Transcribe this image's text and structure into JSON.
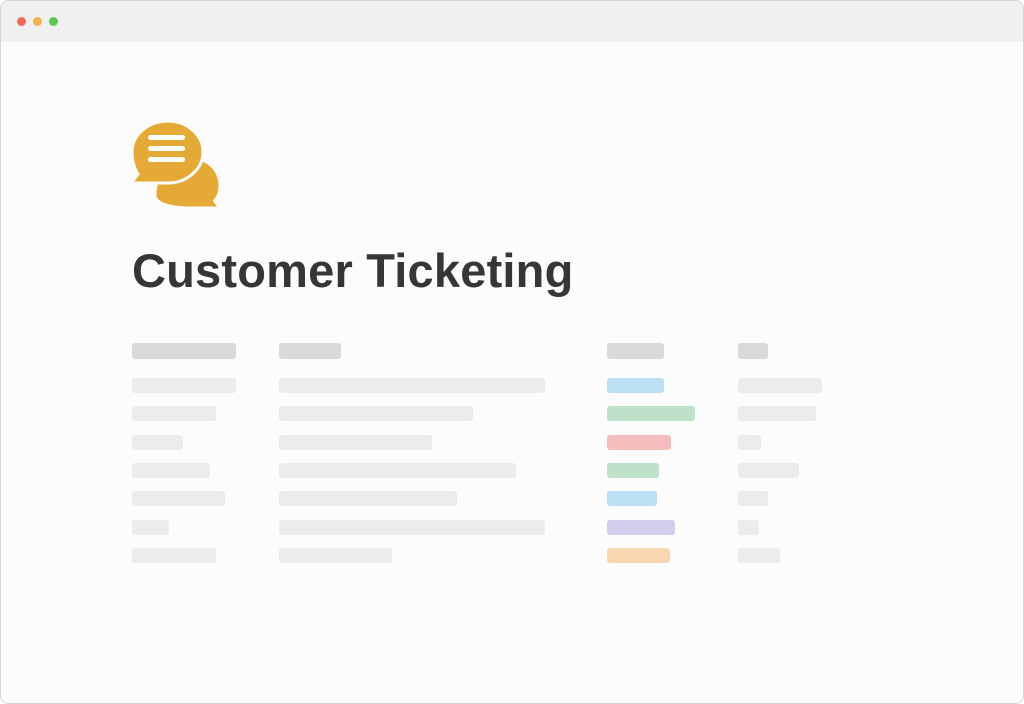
{
  "window": {
    "traffic_lights": [
      "close",
      "minimize",
      "zoom"
    ]
  },
  "page": {
    "icon": "chat-bubbles-icon",
    "icon_color": "#E5A935",
    "title": "Customer Ticketing"
  },
  "table": {
    "columns": 4,
    "rows": 7,
    "status_tag_colors": [
      "#BDDFF4",
      "#BFE0C9",
      "#F5BDBD",
      "#BFE0C9",
      "#BDDFF4",
      "#D4CCEB",
      "#F7D6B2"
    ]
  }
}
